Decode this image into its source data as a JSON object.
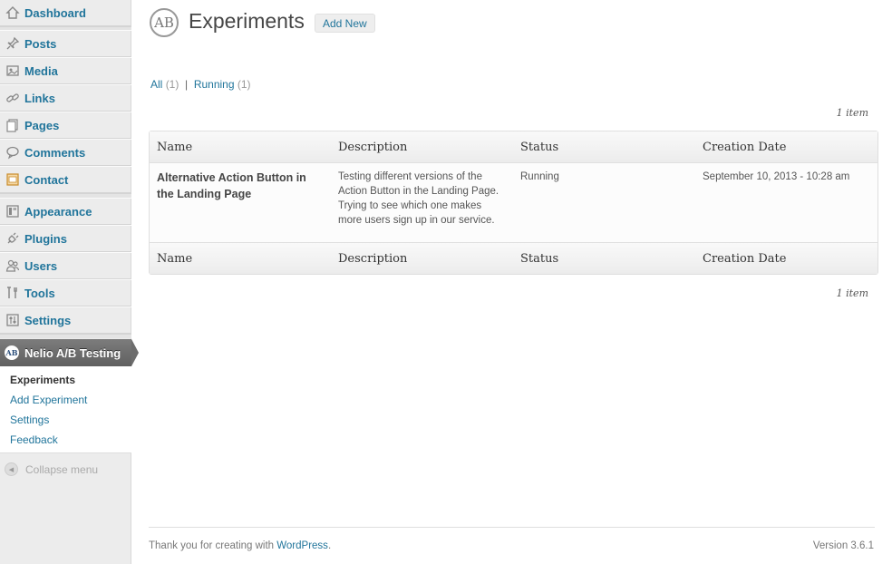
{
  "sidebar": {
    "items": [
      {
        "label": "Dashboard",
        "icon": "dashboard-icon"
      },
      {
        "label": "Posts",
        "icon": "pin-icon"
      },
      {
        "label": "Media",
        "icon": "media-icon"
      },
      {
        "label": "Links",
        "icon": "link-icon"
      },
      {
        "label": "Pages",
        "icon": "pages-icon"
      },
      {
        "label": "Comments",
        "icon": "comment-icon"
      },
      {
        "label": "Contact",
        "icon": "contact-icon"
      },
      {
        "label": "Appearance",
        "icon": "appearance-icon"
      },
      {
        "label": "Plugins",
        "icon": "plugin-icon"
      },
      {
        "label": "Users",
        "icon": "users-icon"
      },
      {
        "label": "Tools",
        "icon": "tools-icon"
      },
      {
        "label": "Settings",
        "icon": "settings-icon"
      }
    ],
    "active": {
      "label": "Nelio A/B Testing",
      "icon_text": "AB"
    },
    "submenu": [
      "Experiments",
      "Add Experiment",
      "Settings",
      "Feedback"
    ],
    "collapse_label": "Collapse menu"
  },
  "header": {
    "logo_text": "AB",
    "title": "Experiments",
    "add_new_label": "Add New"
  },
  "filters": {
    "all_label": "All",
    "all_count": "(1)",
    "separator": "|",
    "running_label": "Running",
    "running_count": "(1)"
  },
  "items_count": "1 item",
  "table": {
    "columns": [
      "Name",
      "Description",
      "Status",
      "Creation Date"
    ],
    "rows": [
      {
        "name": "Alternative Action Button in the Landing Page",
        "description": "Testing different versions of the Action Button in the Landing Page. Trying to see which one makes more users sign up in our service.",
        "status": "Running",
        "created": "September 10, 2013 - 10:28 am"
      }
    ]
  },
  "footer": {
    "thanks_prefix": "Thank you for creating with ",
    "wordpress_link": "WordPress",
    "thanks_suffix": ".",
    "version": "Version 3.6.1"
  },
  "colors": {
    "link": "#21759b",
    "sidebar_bg": "#ececec",
    "active_menu_bg": "#6d6d6d"
  }
}
